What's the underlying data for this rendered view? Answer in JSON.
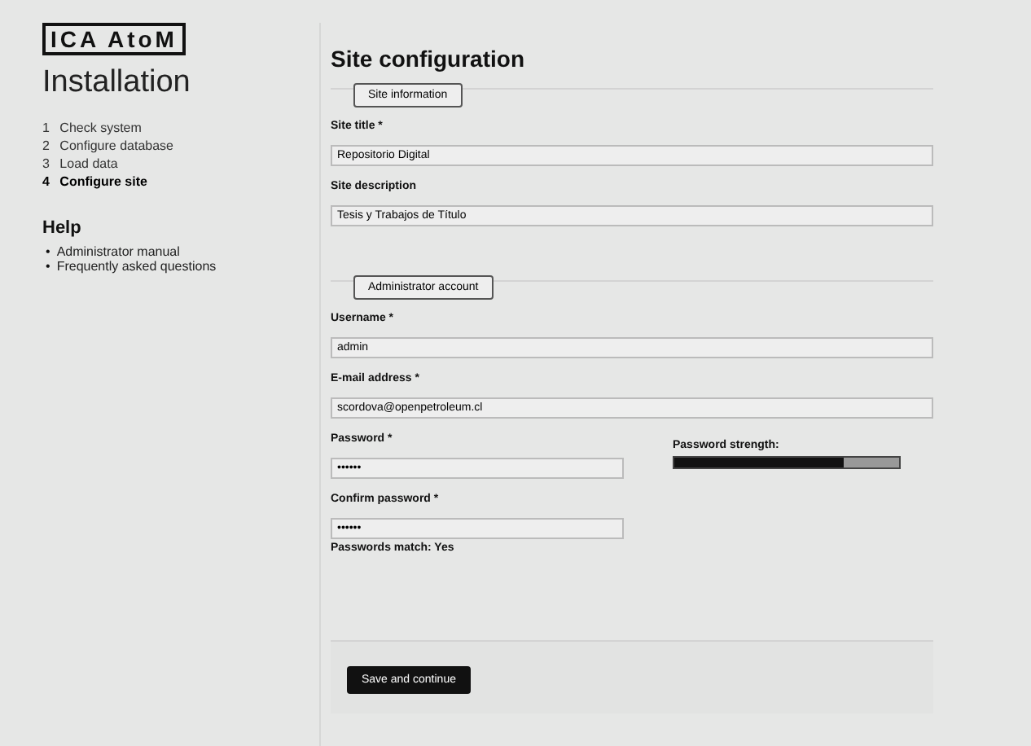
{
  "logo": {
    "text": "ICA AtoM"
  },
  "sidebar": {
    "title": "Installation",
    "steps": [
      {
        "number": "1",
        "label": "Check system",
        "selected": false
      },
      {
        "number": "2",
        "label": "Configure database",
        "selected": false
      },
      {
        "number": "3",
        "label": "Load data",
        "selected": false
      },
      {
        "number": "4",
        "label": "Configure site",
        "selected": true
      }
    ],
    "help_title": "Help",
    "help_links": [
      {
        "bullet": "•",
        "label": "Administrator manual"
      },
      {
        "bullet": "•",
        "label": "Frequently asked questions"
      }
    ]
  },
  "main": {
    "title": "Site configuration",
    "sections": [
      {
        "legend": "Site information",
        "fields": [
          {
            "label": "Site title *",
            "value": "Repositorio Digital",
            "kind": "text"
          },
          {
            "label": "Site description",
            "value": "Tesis y Trabajos de Título",
            "kind": "text"
          }
        ]
      },
      {
        "legend": "Administrator account",
        "fields": [
          {
            "label": "Username *",
            "value": "admin",
            "kind": "text"
          },
          {
            "label": "E-mail address *",
            "value": "scordova@openpetroleum.cl",
            "kind": "text"
          },
          {
            "label": "Password *",
            "value": "••••••",
            "kind": "password",
            "strength_label": "Password strength:",
            "level": 0.75
          },
          {
            "label": "Confirm password *",
            "value": "••••••",
            "kind": "password",
            "note": "Passwords match: Yes"
          }
        ]
      }
    ],
    "submit": "Save and continue"
  }
}
